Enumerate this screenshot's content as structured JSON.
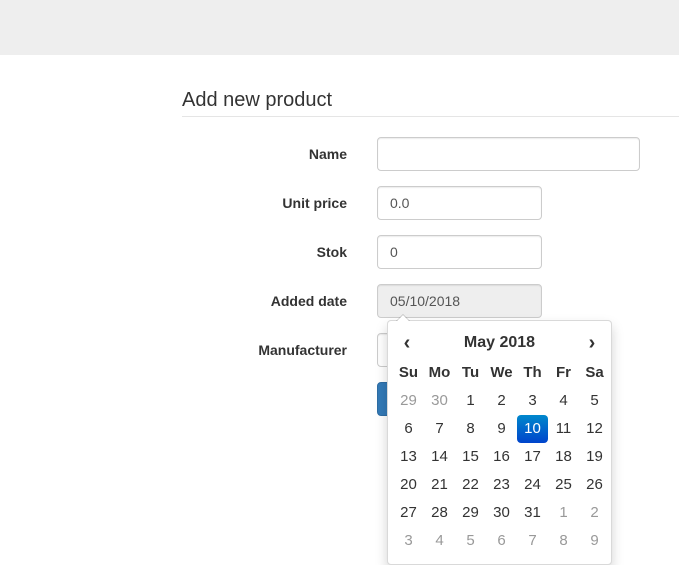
{
  "form": {
    "title": "Add new product",
    "name_label": "Name",
    "name_value": "",
    "unit_price_label": "Unit price",
    "unit_price_value": "0.0",
    "stok_label": "Stok",
    "stok_value": "0",
    "added_date_label": "Added date",
    "added_date_value": "05/10/2018",
    "manufacturer_label": "Manufacturer"
  },
  "datepicker": {
    "month_label": "May 2018",
    "prev_glyph": "‹",
    "next_glyph": "›",
    "weekdays": [
      "Su",
      "Mo",
      "Tu",
      "We",
      "Th",
      "Fr",
      "Sa"
    ],
    "days": [
      {
        "d": "29",
        "t": "old"
      },
      {
        "d": "30",
        "t": "old"
      },
      {
        "d": "1"
      },
      {
        "d": "2"
      },
      {
        "d": "3"
      },
      {
        "d": "4"
      },
      {
        "d": "5"
      },
      {
        "d": "6"
      },
      {
        "d": "7"
      },
      {
        "d": "8"
      },
      {
        "d": "9"
      },
      {
        "d": "10",
        "t": "active"
      },
      {
        "d": "11"
      },
      {
        "d": "12"
      },
      {
        "d": "13"
      },
      {
        "d": "14"
      },
      {
        "d": "15"
      },
      {
        "d": "16"
      },
      {
        "d": "17"
      },
      {
        "d": "18"
      },
      {
        "d": "19"
      },
      {
        "d": "20"
      },
      {
        "d": "21"
      },
      {
        "d": "22"
      },
      {
        "d": "23"
      },
      {
        "d": "24"
      },
      {
        "d": "25"
      },
      {
        "d": "26"
      },
      {
        "d": "27"
      },
      {
        "d": "28"
      },
      {
        "d": "29"
      },
      {
        "d": "30"
      },
      {
        "d": "31"
      },
      {
        "d": "1",
        "t": "new"
      },
      {
        "d": "2",
        "t": "new"
      },
      {
        "d": "3",
        "t": "new"
      },
      {
        "d": "4",
        "t": "new"
      },
      {
        "d": "5",
        "t": "new"
      },
      {
        "d": "6",
        "t": "new"
      },
      {
        "d": "7",
        "t": "new"
      },
      {
        "d": "8",
        "t": "new"
      },
      {
        "d": "9",
        "t": "new"
      }
    ]
  },
  "colors": {
    "accent": "#337ab7",
    "selected_day": "#0062c4"
  }
}
